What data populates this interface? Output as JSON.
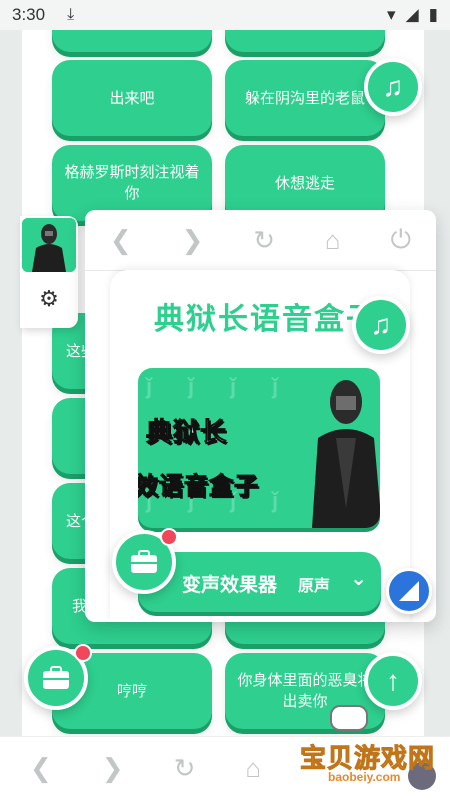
{
  "status_bar": {
    "time": "3:30"
  },
  "grid": {
    "row1_left": "",
    "row1_right": "",
    "row2_left": "出来吧",
    "row2_right": "躲在阴沟里的老鼠",
    "row3_left": "格赫罗斯时刻注视着你",
    "row3_right": "休想逃走",
    "row4_left_partial": "这些",
    "row5_left_partial": "",
    "row6_left_partial": "这个",
    "row7_left_partial": "我",
    "row8_left": "哼哼",
    "row8_right": "你身体里面的恶臭将出卖你"
  },
  "overlay": {
    "title": "典狱长语音盒子",
    "banner_title": "典狱长",
    "banner_subtitle": "效语音盒子",
    "effect_label": "变声效果器",
    "effect_value": "原声"
  },
  "watermark": {
    "title": "宝贝游戏网",
    "url": "baobeiy.com"
  },
  "colors": {
    "accent": "#2ecf8f",
    "accent_dark": "#1c9e69",
    "badge": "#f0485a",
    "blue": "#2a74db"
  }
}
